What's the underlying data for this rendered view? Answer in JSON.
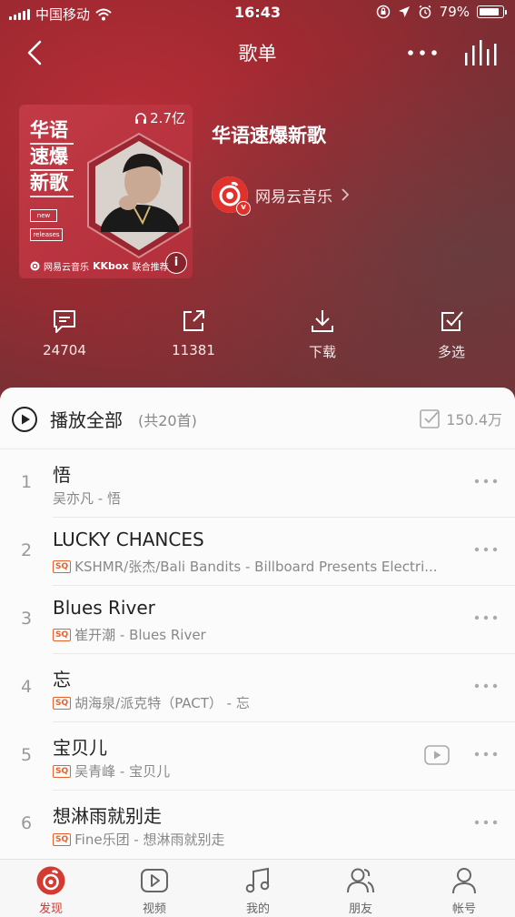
{
  "status_bar": {
    "carrier": "中国移动",
    "time": "16:43",
    "battery_percent": "79%"
  },
  "nav": {
    "title": "歌单"
  },
  "playlist": {
    "cover_title_lines": [
      "华语",
      "速爆",
      "新歌"
    ],
    "cover_tags": [
      "new",
      "releases"
    ],
    "cover_footer_brand": "网易云音乐",
    "cover_footer_partner": "KKbox",
    "cover_footer_suffix": "联合推荐",
    "play_count": "2.7亿",
    "title": "华语速爆新歌",
    "creator": "网易云音乐"
  },
  "actions": [
    {
      "label": "24704",
      "icon": "comment-icon"
    },
    {
      "label": "11381",
      "icon": "share-icon"
    },
    {
      "label": "下载",
      "icon": "download-icon"
    },
    {
      "label": "多选",
      "icon": "multi-select-icon"
    }
  ],
  "play_all": {
    "label": "播放全部",
    "count": "(共20首)",
    "collect_count": "150.4万"
  },
  "songs": [
    {
      "index": "1",
      "title": "悟",
      "subtitle": "吴亦凡 - 悟",
      "sq": false,
      "mv": false
    },
    {
      "index": "2",
      "title": "LUCKY CHANCES",
      "subtitle": "KSHMR/张杰/Bali Bandits - Billboard Presents Electri...",
      "sq": true,
      "mv": false
    },
    {
      "index": "3",
      "title": "Blues River",
      "subtitle": "崔开潮 - Blues River",
      "sq": true,
      "mv": false
    },
    {
      "index": "4",
      "title": "忘",
      "subtitle": "胡海泉/派克特（PACT） - 忘",
      "sq": true,
      "mv": false
    },
    {
      "index": "5",
      "title": "宝贝儿",
      "subtitle": "吴青峰 - 宝贝儿",
      "sq": true,
      "mv": true
    },
    {
      "index": "6",
      "title": "想淋雨就别走",
      "subtitle": "Fine乐团 - 想淋雨就别走",
      "sq": true,
      "mv": false
    }
  ],
  "sq_badge": "SQ",
  "tabs": [
    {
      "label": "发现",
      "icon": "discover-icon",
      "active": true
    },
    {
      "label": "视频",
      "icon": "video-icon",
      "active": false
    },
    {
      "label": "我的",
      "icon": "music-note-icon",
      "active": false
    },
    {
      "label": "朋友",
      "icon": "friends-icon",
      "active": false
    },
    {
      "label": "帐号",
      "icon": "account-icon",
      "active": false
    }
  ],
  "colors": {
    "accent": "#d33a31",
    "hero": "#a5303a",
    "sq_badge": "#e8612b"
  }
}
